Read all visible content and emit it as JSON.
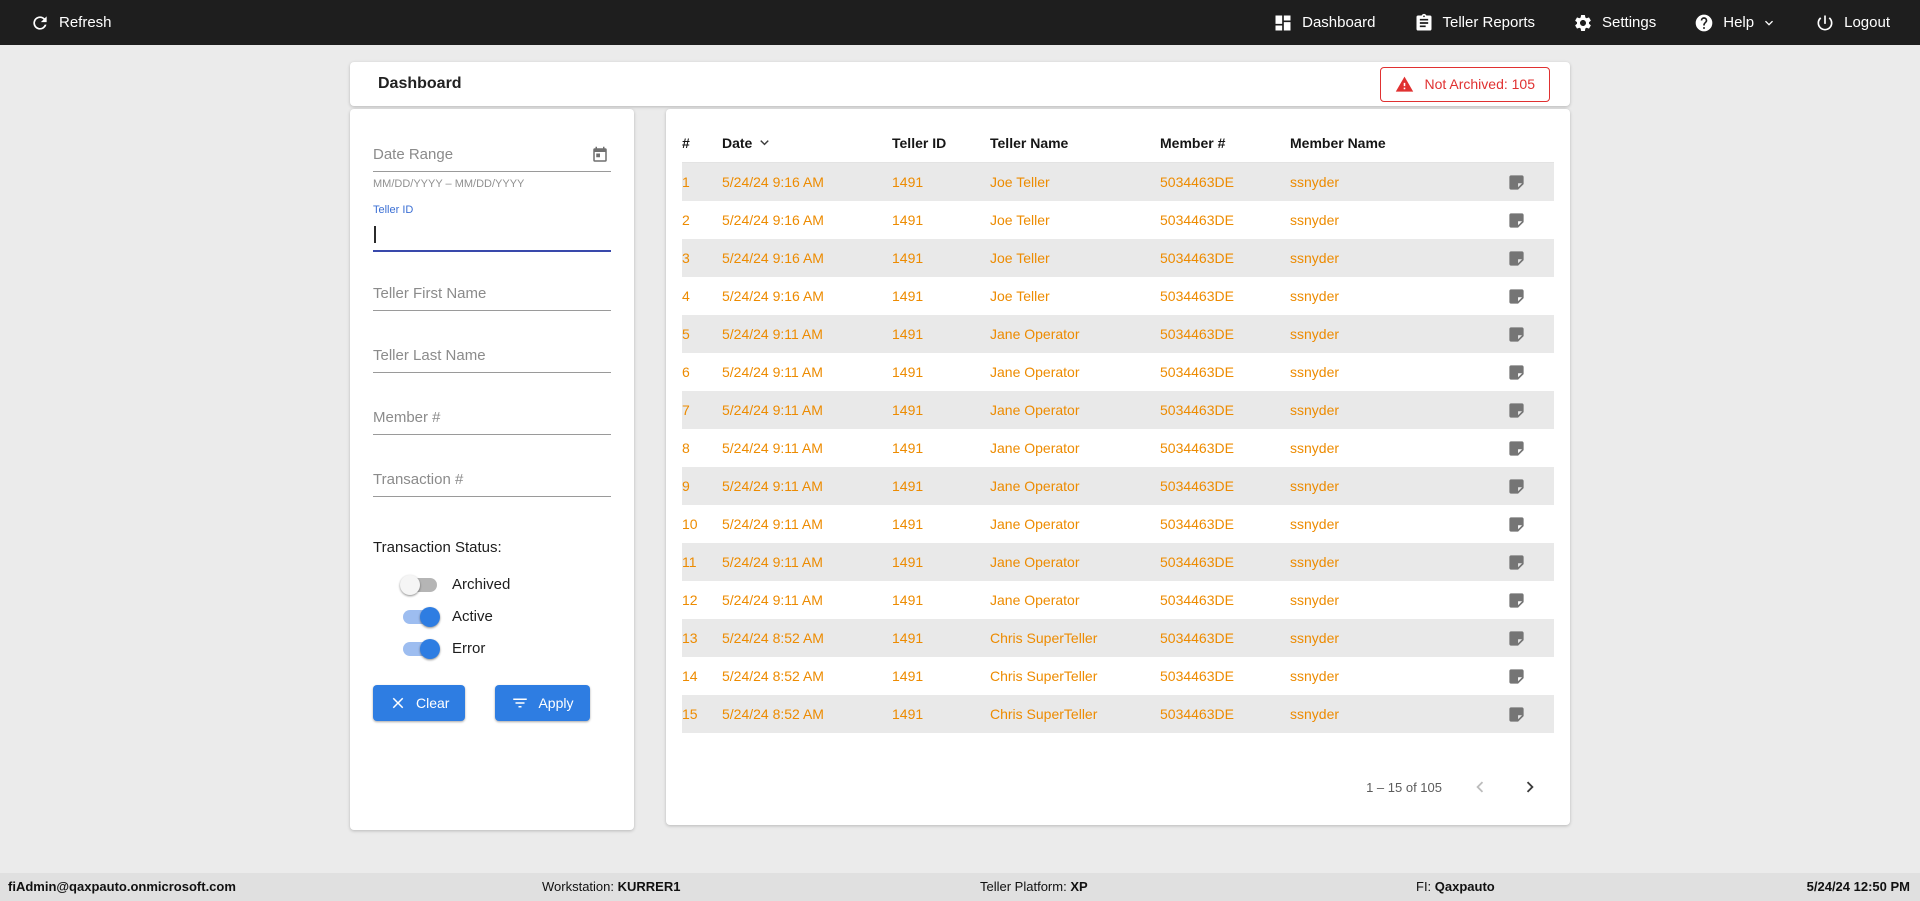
{
  "topbar": {
    "refresh_label": "Refresh",
    "nav": [
      {
        "label": "Dashboard"
      },
      {
        "label": "Teller Reports"
      },
      {
        "label": "Settings"
      },
      {
        "label": "Help"
      },
      {
        "label": "Logout"
      }
    ]
  },
  "header": {
    "title": "Dashboard",
    "badge_label": "Not Archived: 105"
  },
  "filters": {
    "date_range_placeholder": "Date Range",
    "date_range_helper": "MM/DD/YYYY – MM/DD/YYYY",
    "teller_id_label": "Teller ID",
    "teller_id_value": "",
    "teller_first_placeholder": "Teller First Name",
    "teller_last_placeholder": "Teller Last Name",
    "member_placeholder": "Member #",
    "transaction_placeholder": "Transaction #",
    "status_label": "Transaction Status:",
    "toggles": [
      {
        "label": "Archived",
        "on": false
      },
      {
        "label": "Active",
        "on": true
      },
      {
        "label": "Error",
        "on": true
      }
    ],
    "clear_label": "Clear",
    "apply_label": "Apply"
  },
  "table": {
    "columns": [
      "#",
      "Date",
      "Teller ID",
      "Teller Name",
      "Member #",
      "Member Name"
    ],
    "rows": [
      {
        "num": "1",
        "date": "5/24/24 9:16 AM",
        "teller_id": "1491",
        "teller_name": "Joe Teller",
        "member_num": "5034463DE",
        "member_name": "ssnyder"
      },
      {
        "num": "2",
        "date": "5/24/24 9:16 AM",
        "teller_id": "1491",
        "teller_name": "Joe Teller",
        "member_num": "5034463DE",
        "member_name": "ssnyder"
      },
      {
        "num": "3",
        "date": "5/24/24 9:16 AM",
        "teller_id": "1491",
        "teller_name": "Joe Teller",
        "member_num": "5034463DE",
        "member_name": "ssnyder"
      },
      {
        "num": "4",
        "date": "5/24/24 9:16 AM",
        "teller_id": "1491",
        "teller_name": "Joe Teller",
        "member_num": "5034463DE",
        "member_name": "ssnyder"
      },
      {
        "num": "5",
        "date": "5/24/24 9:11 AM",
        "teller_id": "1491",
        "teller_name": "Jane Operator",
        "member_num": "5034463DE",
        "member_name": "ssnyder"
      },
      {
        "num": "6",
        "date": "5/24/24 9:11 AM",
        "teller_id": "1491",
        "teller_name": "Jane Operator",
        "member_num": "5034463DE",
        "member_name": "ssnyder"
      },
      {
        "num": "7",
        "date": "5/24/24 9:11 AM",
        "teller_id": "1491",
        "teller_name": "Jane Operator",
        "member_num": "5034463DE",
        "member_name": "ssnyder"
      },
      {
        "num": "8",
        "date": "5/24/24 9:11 AM",
        "teller_id": "1491",
        "teller_name": "Jane Operator",
        "member_num": "5034463DE",
        "member_name": "ssnyder"
      },
      {
        "num": "9",
        "date": "5/24/24 9:11 AM",
        "teller_id": "1491",
        "teller_name": "Jane Operator",
        "member_num": "5034463DE",
        "member_name": "ssnyder"
      },
      {
        "num": "10",
        "date": "5/24/24 9:11 AM",
        "teller_id": "1491",
        "teller_name": "Jane Operator",
        "member_num": "5034463DE",
        "member_name": "ssnyder"
      },
      {
        "num": "11",
        "date": "5/24/24 9:11 AM",
        "teller_id": "1491",
        "teller_name": "Jane Operator",
        "member_num": "5034463DE",
        "member_name": "ssnyder"
      },
      {
        "num": "12",
        "date": "5/24/24 9:11 AM",
        "teller_id": "1491",
        "teller_name": "Jane Operator",
        "member_num": "5034463DE",
        "member_name": "ssnyder"
      },
      {
        "num": "13",
        "date": "5/24/24 8:52 AM",
        "teller_id": "1491",
        "teller_name": "Chris SuperTeller",
        "member_num": "5034463DE",
        "member_name": "ssnyder"
      },
      {
        "num": "14",
        "date": "5/24/24 8:52 AM",
        "teller_id": "1491",
        "teller_name": "Chris SuperTeller",
        "member_num": "5034463DE",
        "member_name": "ssnyder"
      },
      {
        "num": "15",
        "date": "5/24/24 8:52 AM",
        "teller_id": "1491",
        "teller_name": "Chris SuperTeller",
        "member_num": "5034463DE",
        "member_name": "ssnyder"
      }
    ],
    "pagination_label": "1 – 15 of 105"
  },
  "footer": {
    "email": "fiAdmin@qaxpauto.onmicrosoft.com",
    "workstation_label": "Workstation: ",
    "workstation_value": "KURRER1",
    "platform_label": "Teller Platform: ",
    "platform_value": "XP",
    "fi_label": "FI: ",
    "fi_value": "Qaxpauto",
    "datetime": "5/24/24 12:50 PM"
  },
  "colors": {
    "topbar_bg": "#1E1E1E",
    "accent_blue": "#2E7DE2",
    "focused_field_blue": "#3949AB",
    "row_text_orange": "#ED8B00",
    "alert_red": "#E03131"
  }
}
